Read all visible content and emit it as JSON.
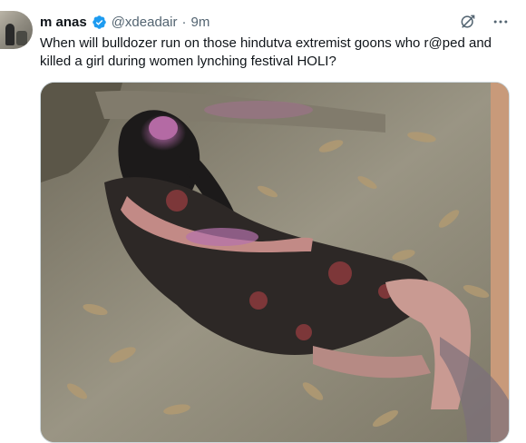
{
  "tweet": {
    "author_name": "m anas",
    "handle": "@xdeadair",
    "separator": "·",
    "time": "9m",
    "text": "When will bulldozer run on those hindutva extremist goons who r@ped and killed a girl during women lynching festival HOLI?"
  },
  "icons": {
    "verified": "verified-badge-icon",
    "grok": "grok-icon",
    "more": "more-icon"
  },
  "colors": {
    "verified": "#1d9bf0",
    "secondary_text": "#536471"
  }
}
